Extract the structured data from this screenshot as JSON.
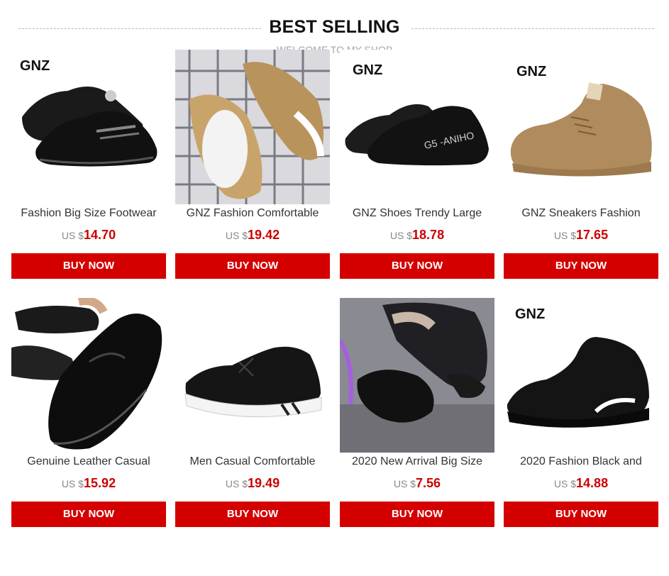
{
  "section": {
    "title": "BEST SELLING",
    "subtitle": "WELCOME TO MY SHOP"
  },
  "products": [
    {
      "brand": "GNZ",
      "name": "Fashion Big Size Footwear",
      "currency": "US $",
      "price": "14.70",
      "button": "BUY NOW",
      "image": "black-sneaker-pair"
    },
    {
      "brand": "",
      "name": "GNZ Fashion Comfortable",
      "currency": "US $",
      "price": "19.42",
      "button": "BUY NOW",
      "image": "khaki-sneaker-pair-on-grid"
    },
    {
      "brand": "GNZ",
      "name": "GNZ Shoes Trendy Large",
      "currency": "US $",
      "price": "18.78",
      "button": "BUY NOW",
      "image": "black-sneaker-pair-g5"
    },
    {
      "brand": "GNZ",
      "name": "GNZ Sneakers Fashion",
      "currency": "US $",
      "price": "17.65",
      "button": "BUY NOW",
      "image": "tan-knit-sneaker"
    },
    {
      "brand": "",
      "name": "Genuine Leather Casual",
      "currency": "US $",
      "price": "15.92",
      "button": "BUY NOW",
      "image": "black-leather-loafer"
    },
    {
      "brand": "",
      "name": "Men Casual Comfortable",
      "currency": "US $",
      "price": "19.49",
      "button": "BUY NOW",
      "image": "black-white-sole-sneaker"
    },
    {
      "brand": "",
      "name": "2020 New Arrival Big Size",
      "currency": "US $",
      "price": "7.56",
      "button": "BUY NOW",
      "image": "person-tying-black-sneaker"
    },
    {
      "brand": "GNZ",
      "name": "2020 Fashion Black and",
      "currency": "US $",
      "price": "14.88",
      "button": "BUY NOW",
      "image": "black-sock-sneaker"
    }
  ],
  "colors": {
    "button_bg": "#d40000",
    "price": "#cc0000"
  }
}
